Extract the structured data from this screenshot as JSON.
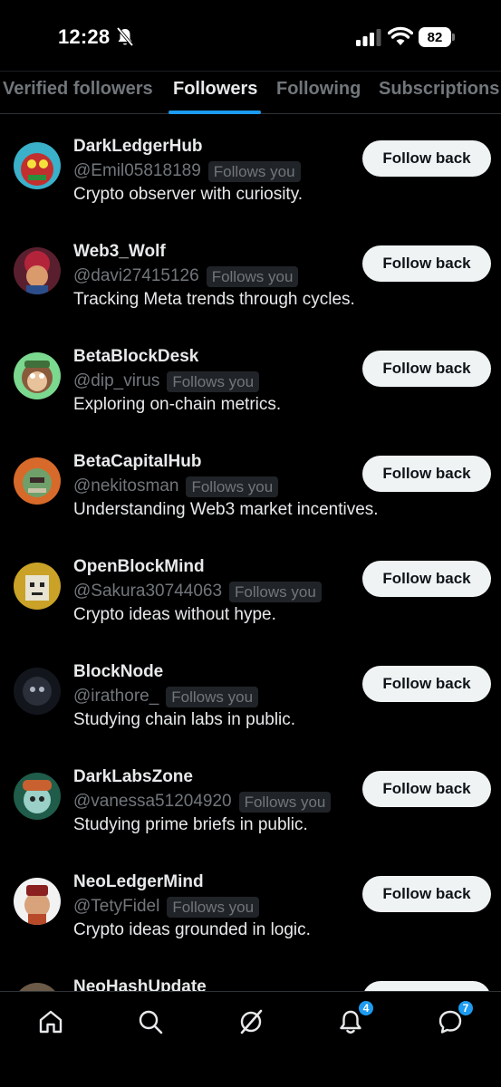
{
  "status_bar": {
    "time": "12:28",
    "battery": "82"
  },
  "tabs": [
    {
      "label": "Verified followers",
      "active": false
    },
    {
      "label": "Followers",
      "active": true
    },
    {
      "label": "Following",
      "active": false
    },
    {
      "label": "Subscriptions",
      "active": false
    }
  ],
  "follows_you_label": "Follows you",
  "follow_back_label": "Follow back",
  "users": [
    {
      "name": "DarkLedgerHub",
      "handle": "@Emil05818189",
      "bio": "Crypto observer with curiosity."
    },
    {
      "name": "Web3_Wolf",
      "handle": "@davi27415126",
      "bio": "Tracking Meta trends through cycles."
    },
    {
      "name": "BetaBlockDesk",
      "handle": "@dip_virus",
      "bio": "Exploring on-chain metrics."
    },
    {
      "name": "BetaCapitalHub",
      "handle": "@nekitosman",
      "bio": "Understanding Web3 market incentives."
    },
    {
      "name": "OpenBlockMind",
      "handle": "@Sakura30744063",
      "bio": "Crypto ideas without hype."
    },
    {
      "name": "BlockNode",
      "handle": "@irathore_",
      "bio": "Studying chain labs in public."
    },
    {
      "name": "DarkLabsZone",
      "handle": "@vanessa51204920",
      "bio": "Studying prime briefs in public."
    },
    {
      "name": "NeoLedgerMind",
      "handle": "@TetyFidel",
      "bio": "Crypto ideas grounded in logic."
    },
    {
      "name": "NeoHashUpdate",
      "handle": "",
      "bio": ""
    }
  ],
  "bottom_nav": {
    "notifications_badge": "4",
    "messages_badge": "7"
  }
}
